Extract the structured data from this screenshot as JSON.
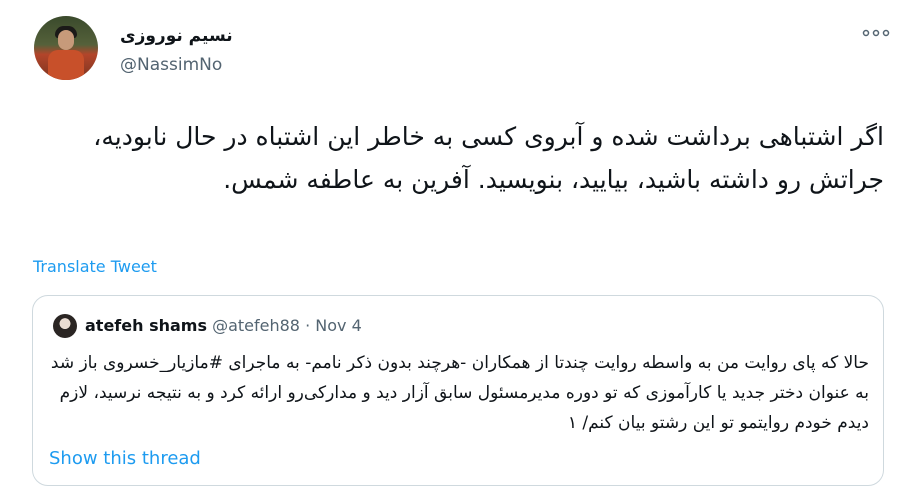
{
  "author": {
    "display_name": "نسیم نوروزی",
    "handle": "@NassimNo"
  },
  "icons": {
    "more": "more-horizontal-icon",
    "avatar": "profile-photo"
  },
  "tweet": {
    "text": "اگر اشتباهی برداشت شده و آبروی کسی به خاطر این اشتباه در حال نابودیه، جراتش رو داشته باشید، بیایید، بنویسید. آفرین به عاطفه شمس.",
    "translate_label": "Translate Tweet"
  },
  "quoted": {
    "display_name": "atefeh shams",
    "handle": "@atefeh88",
    "separator": "·",
    "date": "Nov 4",
    "text": "حالا که پای روایت من به واسطه روایت چندتا از همکاران -هرچند بدون ذکر نامم- به ماجرای #مازیار_خسروی باز شد به عنوان دختر جدید یا کارآموزی که تو دوره مدیرمسئول سابق آزار دید و مدارکی‌رو ارائه کرد و به نتیجه نرسید، لازم دیدم خودم روایتمو تو این رشتو بیان کنم/ ۱",
    "show_thread_label": "Show this thread"
  },
  "colors": {
    "link": "#1d9bf0",
    "secondary_text": "#536471",
    "border": "#cfd9de"
  }
}
